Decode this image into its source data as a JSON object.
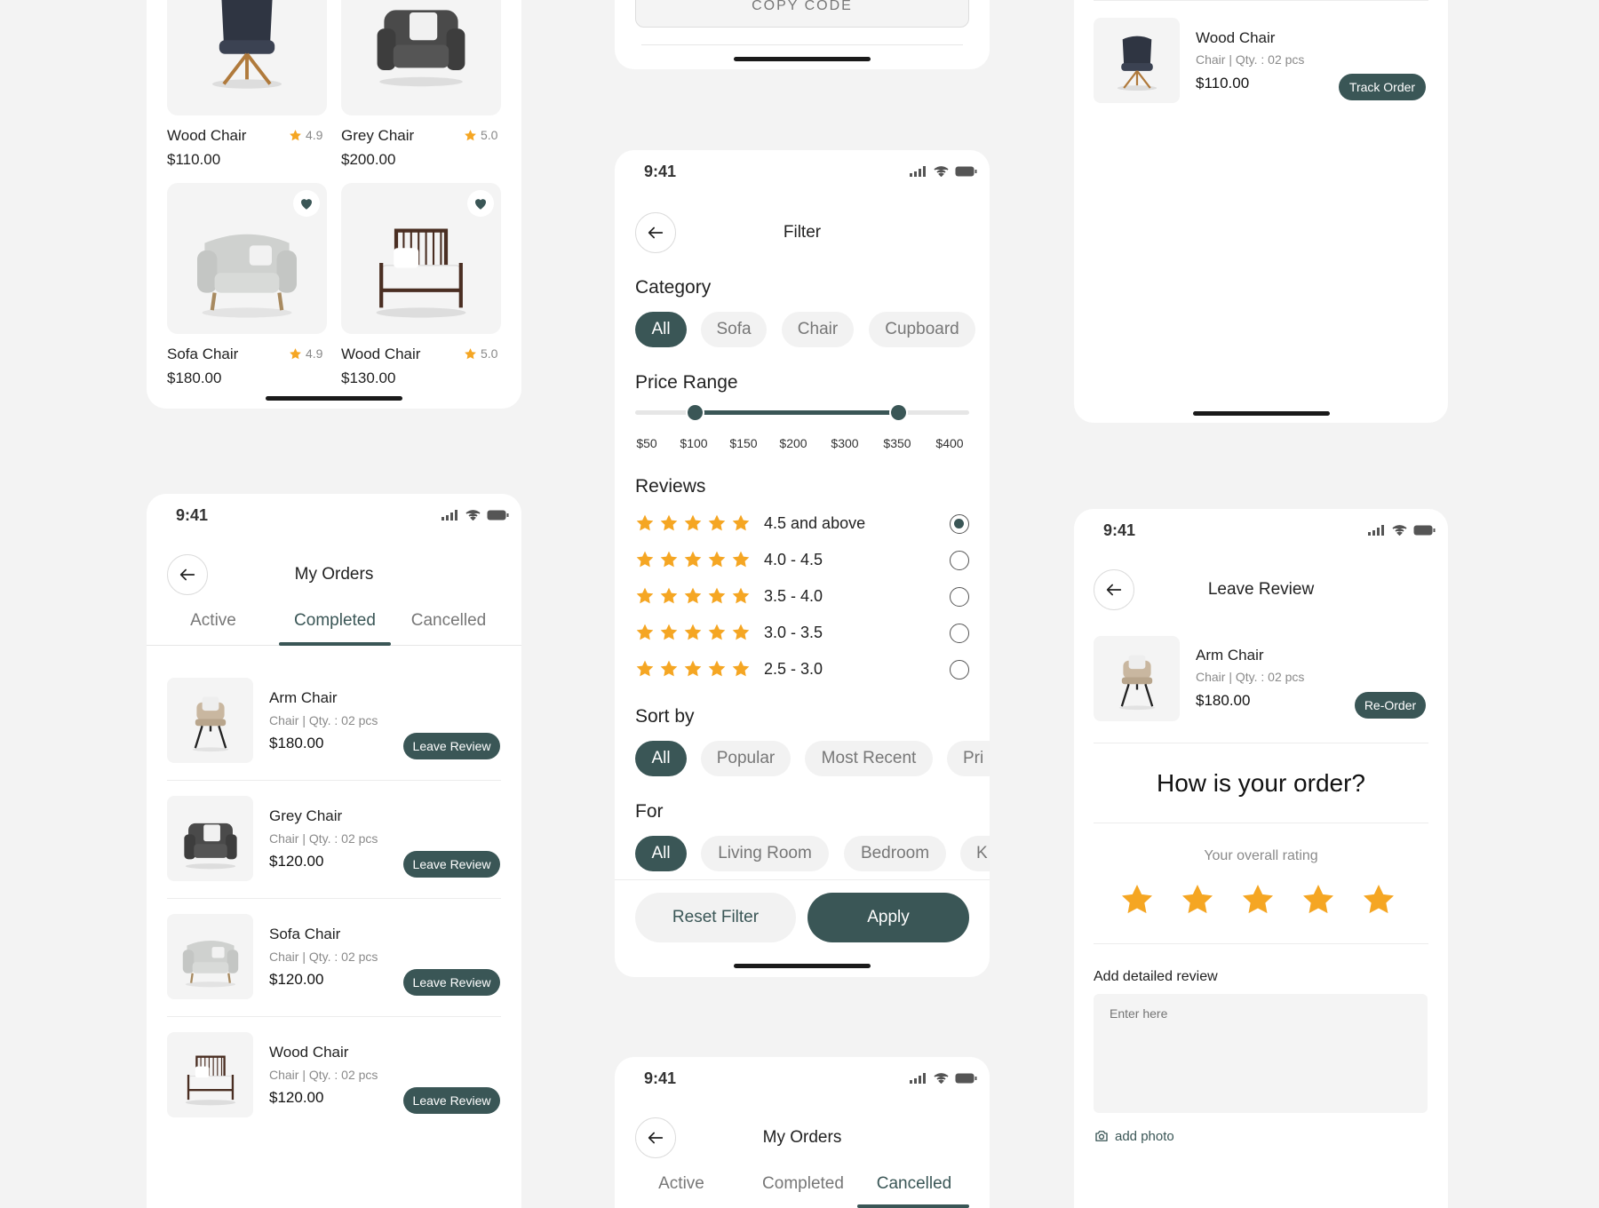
{
  "colors": {
    "accent": "#3a5656",
    "star": "#f5a623",
    "bg": "#f3f3f3"
  },
  "products": [
    {
      "name": "Wood Chair",
      "rating": "4.9",
      "price": "$110.00"
    },
    {
      "name": "Grey Chair",
      "rating": "5.0",
      "price": "$200.00"
    },
    {
      "name": "Sofa Chair",
      "rating": "4.9",
      "price": "$180.00"
    },
    {
      "name": "Wood Chair",
      "rating": "5.0",
      "price": "$130.00"
    }
  ],
  "coupon": {
    "copy_label": "COPY CODE"
  },
  "filter": {
    "time": "9:41",
    "title": "Filter",
    "category_heading": "Category",
    "categories": [
      "All",
      "Sofa",
      "Chair",
      "Cupboard"
    ],
    "price_heading": "Price Range",
    "price_ticks": [
      "$50",
      "$100",
      "$150",
      "$200",
      "$300",
      "$350",
      "$400"
    ],
    "price_selected": {
      "min": "$100",
      "max": "$350"
    },
    "reviews_heading": "Reviews",
    "reviews": [
      "4.5 and above",
      "4.0 - 4.5",
      "3.5 - 4.0",
      "3.0 - 3.5",
      "2.5 - 3.0"
    ],
    "sort_heading": "Sort by",
    "sort": [
      "All",
      "Popular",
      "Most Recent",
      "Pri"
    ],
    "for_heading": "For",
    "for": [
      "All",
      "Living Room",
      "Bedroom",
      "K"
    ],
    "reset_label": "Reset Filter",
    "apply_label": "Apply"
  },
  "track": {
    "name": "Wood Chair",
    "meta": "Chair | Qty. : 02 pcs",
    "price": "$110.00",
    "button": "Track Order"
  },
  "orders": {
    "time": "9:41",
    "title": "My Orders",
    "tabs": [
      "Active",
      "Completed",
      "Cancelled"
    ],
    "items": [
      {
        "name": "Arm Chair",
        "meta": "Chair | Qty. : 02 pcs",
        "price": "$180.00",
        "button": "Leave Review"
      },
      {
        "name": "Grey Chair",
        "meta": "Chair | Qty. : 02 pcs",
        "price": "$120.00",
        "button": "Leave Review"
      },
      {
        "name": "Sofa Chair",
        "meta": "Chair | Qty. : 02 pcs",
        "price": "$120.00",
        "button": "Leave Review"
      },
      {
        "name": "Wood Chair",
        "meta": "Chair | Qty. : 02 pcs",
        "price": "$120.00",
        "button": "Leave Review"
      }
    ]
  },
  "orders2": {
    "time": "9:41",
    "title": "My Orders",
    "tabs": [
      "Active",
      "Completed",
      "Cancelled"
    ]
  },
  "review": {
    "time": "9:41",
    "title": "Leave Review",
    "item": {
      "name": "Arm Chair",
      "meta": "Chair | Qty. : 02 pcs",
      "price": "$180.00",
      "button": "Re-Order"
    },
    "question": "How is your order?",
    "rating_label": "Your overall rating",
    "rating": 5,
    "detail_heading": "Add detailed review",
    "placeholder": "Enter here",
    "add_photo": "add photo"
  }
}
